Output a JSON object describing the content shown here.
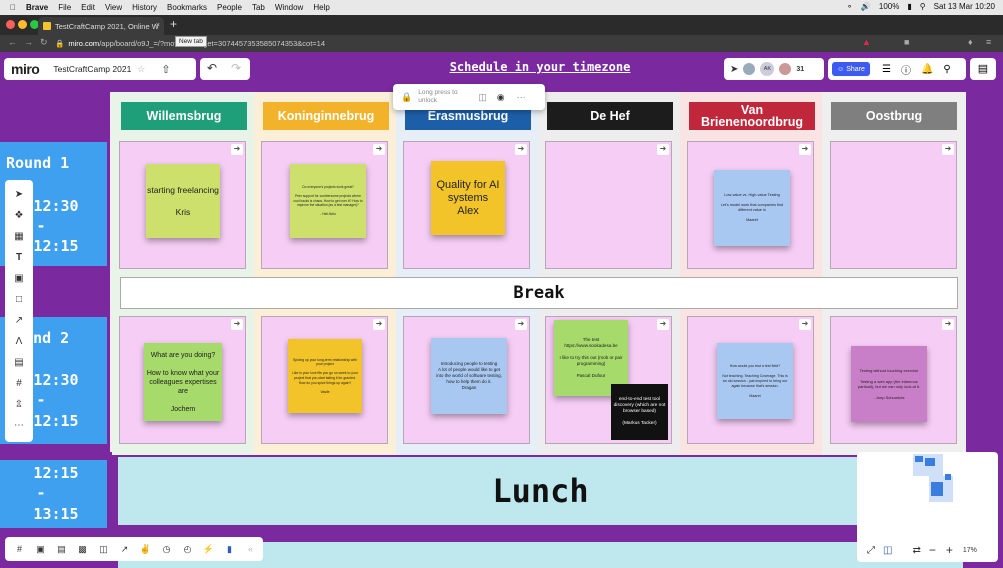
{
  "menubar": {
    "app": "Brave",
    "items": [
      "File",
      "Edit",
      "View",
      "History",
      "Bookmarks",
      "People",
      "Tab",
      "Window",
      "Help"
    ],
    "battery": "100%",
    "datetime": "Sat 13 Mar  10:20"
  },
  "browser": {
    "tab_title": "TestCraftCamp 2021, Online W",
    "new_tab_tooltip": "New tab",
    "url_host": "miro.com",
    "url_path": "/app/board/o9J_",
    "url_tail": "=/?moveToWidget=3074457353585074353&cot=14"
  },
  "miro": {
    "logo": "miro",
    "board_name": "TestCraftCamp 2021",
    "schedule_link": "Schedule in your timezone",
    "participants_count": "31",
    "share_label": "Share",
    "lock_hint": "Long press to unlock",
    "collaborators": [
      "AK"
    ]
  },
  "columns": [
    {
      "name": "Willemsbrug",
      "color": "#1f9e7a"
    },
    {
      "name": "Koninginnebrug",
      "color": "#f2b32a"
    },
    {
      "name": "Erasmusbrug",
      "color": "#1c5fa8"
    },
    {
      "name": "De Hef",
      "color": "#1c1c1c"
    },
    {
      "name": "Van Brienenoordbrug",
      "color": "#c1273a"
    },
    {
      "name": "Oostbrug",
      "color": "#7f7f7f"
    }
  ],
  "rounds": {
    "r1_label": "Round 1",
    "r1_start": "12:30",
    "r1_dash": "-",
    "r1_end": "12:15",
    "r2_label": "Round 2",
    "r2_start": "12:30",
    "r2_dash": "-",
    "r2_end": "12:15",
    "lunch_start": "12:15",
    "lunch_dash": "-",
    "lunch_end": "13:15"
  },
  "break_label": "Break",
  "lunch_label": "Lunch",
  "round1": [
    {
      "text": "starting freelancing\n\nKris",
      "bg": "#cde06b"
    },
    {
      "text": "Do everyone's projects work great?\n\nPeer support for cumbersome projects where cool hacks is chaos. How to get over it? How to improve the situation (as a test manager)?\n\n- Heli-Nelu",
      "bg": "#cde06b"
    },
    {
      "text": "Quality for AI systems\nAlex",
      "bg": "#f2c42a"
    },
    null,
    {
      "text": "Low-value vs. High-value Testing\n\nLet's model work that companies find different value in\n\nMaaret",
      "bg": "#a8c8f2"
    },
    null
  ],
  "round2": [
    {
      "text": "What are you doing?\n\nHow to know what your colleagues expertises are\n\nJochem",
      "bg": "#a6da6a"
    },
    {
      "text": "Spicing up your long-term relationship with your project\n\nLike in your love life you go on week to your project that you start taking it for granted. How do you spice things up again?\n\nVasile",
      "bg": "#f2c42a"
    },
    {
      "text": "Introducing people to testing\nA lot of people would like to get into the world of software testing, how to help them do it.\nDragan",
      "bg": "#a8c8f2"
    },
    {
      "text": "The test https://www.sookadesa.be\n\nI like to try this out (mob or pair programming)\n\nPascal Dufour",
      "bg": "#a6da6a"
    },
    {
      "text": "How would you test a test field?\n\nNot teaching. Teaching Coverage. This is an old session - just inspired to bring our again because that's session.\n\nMaaret",
      "bg": "#a8c8f2"
    },
    {
      "text": "Testing without touching exercise\n\nTesting a web app (the infamous particall), but we can only look at it.\n\n- Joep Schuurkes",
      "bg": "#c97fc8"
    }
  ],
  "dark_note": {
    "text": "end-to-end test tool discovery (which are not browser based)\n\n(Markus Tacker)"
  },
  "zoom": {
    "level": "17%"
  }
}
